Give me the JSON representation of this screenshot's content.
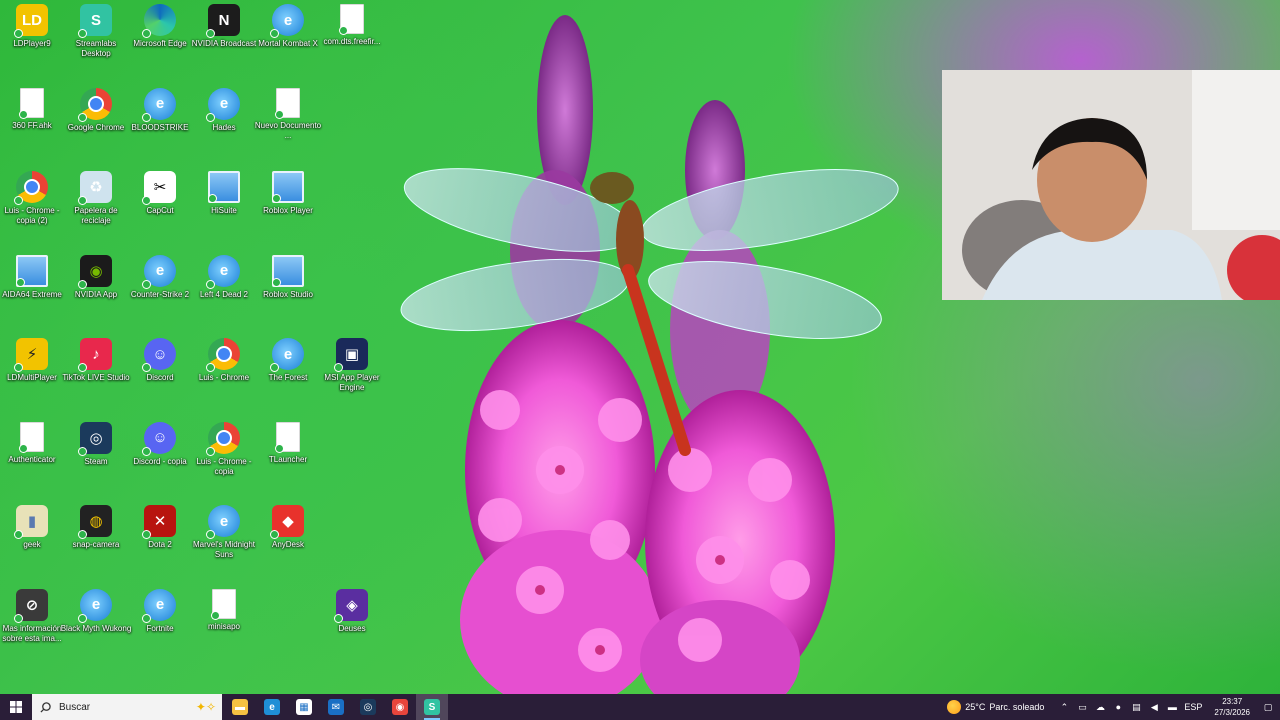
{
  "desktop": {
    "icons": [
      {
        "label": "LDPlayer9",
        "icon": "ldplayer-icon",
        "style": "sq",
        "bg": "#f2c300",
        "text": "LD"
      },
      {
        "label": "Streamlabs Desktop",
        "icon": "streamlabs-icon",
        "style": "sq",
        "bg": "#31c3a2",
        "text": "S"
      },
      {
        "label": "Microsoft Edge",
        "icon": "edge-icon",
        "style": "edge"
      },
      {
        "label": "NVIDIA Broadcast",
        "icon": "nvidia-broadcast-icon",
        "style": "sq",
        "bg": "#1c1c1c",
        "text": "N"
      },
      {
        "label": "Mortal Kombat X",
        "icon": "internet-explorer-icon",
        "style": "ie"
      },
      {
        "label": "com.dts.freefir...",
        "icon": "file-icon",
        "style": "file"
      },
      {
        "label": "360 FF.ahk",
        "icon": "file-icon",
        "style": "file"
      },
      {
        "label": "Google Chrome",
        "icon": "chrome-icon",
        "style": "chrome"
      },
      {
        "label": "BLOODSTRIKE",
        "icon": "internet-explorer-icon",
        "style": "ie"
      },
      {
        "label": "Hades",
        "icon": "internet-explorer-icon",
        "style": "ie"
      },
      {
        "label": "Nuevo Documento ...",
        "icon": "file-icon",
        "style": "file"
      },
      {
        "label": "Luis - Chrome - copia (2)",
        "icon": "chrome-icon",
        "style": "chrome"
      },
      {
        "label": "Papelera de reciclaje",
        "icon": "recycle-bin-icon",
        "style": "sq",
        "bg": "#cfe3ee",
        "text": "♻"
      },
      {
        "label": "CapCut",
        "icon": "capcut-icon",
        "style": "sq",
        "bg": "#ffffff",
        "text": "✂",
        "fg": "#000"
      },
      {
        "label": "HiSuite",
        "icon": "window-icon",
        "style": "win"
      },
      {
        "label": "Roblox Player",
        "icon": "window-icon",
        "style": "win"
      },
      {
        "label": "AIDA64 Extreme",
        "icon": "window-icon",
        "style": "win"
      },
      {
        "label": "NVIDIA App",
        "icon": "nvidia-icon",
        "style": "sq",
        "bg": "#1b1b1b",
        "text": "◉",
        "fg": "#76b900"
      },
      {
        "label": "Counter-Strike 2",
        "icon": "internet-explorer-icon",
        "style": "ie"
      },
      {
        "label": "Left 4 Dead 2",
        "icon": "internet-explorer-icon",
        "style": "ie"
      },
      {
        "label": "Roblox Studio",
        "icon": "window-icon",
        "style": "win"
      },
      {
        "label": "LDMultiPlayer",
        "icon": "ldmultiplayer-icon",
        "style": "sq",
        "bg": "#f2c300",
        "text": "⚡",
        "fg": "#222"
      },
      {
        "label": "TikTok LIVE Studio",
        "icon": "tiktok-icon",
        "style": "sq",
        "bg": "#e8284c",
        "text": "♪"
      },
      {
        "label": "Discord",
        "icon": "discord-icon",
        "style": "discord"
      },
      {
        "label": "Luis - Chrome",
        "icon": "chrome-icon",
        "style": "chrome"
      },
      {
        "label": "The Forest",
        "icon": "internet-explorer-icon",
        "style": "ie"
      },
      {
        "label": "MSI App Player Engine",
        "icon": "msi-app-player-icon",
        "style": "sq",
        "bg": "#1a2a5a",
        "text": "▣"
      },
      {
        "label": "Authenticator",
        "icon": "file-icon",
        "style": "file"
      },
      {
        "label": "Steam",
        "icon": "steam-icon",
        "style": "sq",
        "bg": "#1b3a5c",
        "text": "◎"
      },
      {
        "label": "Discord - copia",
        "icon": "discord-icon",
        "style": "discord"
      },
      {
        "label": "Luis - Chrome - copia",
        "icon": "chrome-icon",
        "style": "chrome"
      },
      {
        "label": "TLauncher",
        "icon": "file-icon",
        "style": "file"
      },
      {
        "label": "geek",
        "icon": "geek-icon",
        "style": "sq",
        "bg": "#e8e2b8",
        "text": "▮",
        "fg": "#5a7ab0"
      },
      {
        "label": "snap-camera",
        "icon": "snap-camera-icon",
        "style": "sq",
        "bg": "#222",
        "text": "◍",
        "fg": "#f2c300"
      },
      {
        "label": "Dota 2",
        "icon": "dota2-icon",
        "style": "sq",
        "bg": "#b8140f",
        "text": "✕"
      },
      {
        "label": "Marvel's Midnight Suns",
        "icon": "internet-explorer-icon",
        "style": "ie"
      },
      {
        "label": "AnyDesk",
        "icon": "anydesk-icon",
        "style": "sq",
        "bg": "#e8322c",
        "text": "◆"
      },
      {
        "label": "Mas información sobre esta ima...",
        "icon": "info-icon",
        "style": "sq",
        "bg": "#3a3a3a",
        "text": "⊘"
      },
      {
        "label": "Black Myth Wukong",
        "icon": "internet-explorer-icon",
        "style": "ie"
      },
      {
        "label": "Fortnite",
        "icon": "internet-explorer-icon",
        "style": "ie"
      },
      {
        "label": "minisapo",
        "icon": "file-icon",
        "style": "file"
      },
      {
        "label": "Deuses",
        "icon": "deuses-icon",
        "style": "sq",
        "bg": "#5a2ea0",
        "text": "◈"
      }
    ]
  },
  "taskbar": {
    "search_placeholder": "Buscar",
    "pinned": [
      {
        "name": "file-explorer",
        "icon": "folder-icon",
        "bg": "#f5c242",
        "text": "▬",
        "active": false
      },
      {
        "name": "edge",
        "icon": "edge-icon",
        "bg": "#1f8fd6",
        "text": "e",
        "active": false
      },
      {
        "name": "microsoft-store",
        "icon": "store-icon",
        "bg": "#ffffff",
        "text": "▦",
        "active": false
      },
      {
        "name": "mail",
        "icon": "mail-icon",
        "bg": "#1a6fc4",
        "text": "✉",
        "active": false
      },
      {
        "name": "steam",
        "icon": "steam-icon",
        "bg": "#1b3a5c",
        "text": "◎",
        "active": false
      },
      {
        "name": "chrome",
        "icon": "chrome-icon",
        "bg": "#e8453c",
        "text": "◉",
        "active": false
      },
      {
        "name": "streamlabs",
        "icon": "streamlabs-icon",
        "bg": "#31c3a2",
        "text": "S",
        "active": true
      }
    ],
    "weather": {
      "temp": "25°C",
      "condition": "Parc. soleado"
    },
    "language": "ESP",
    "time": "23:37",
    "date": "27/3/2026"
  }
}
